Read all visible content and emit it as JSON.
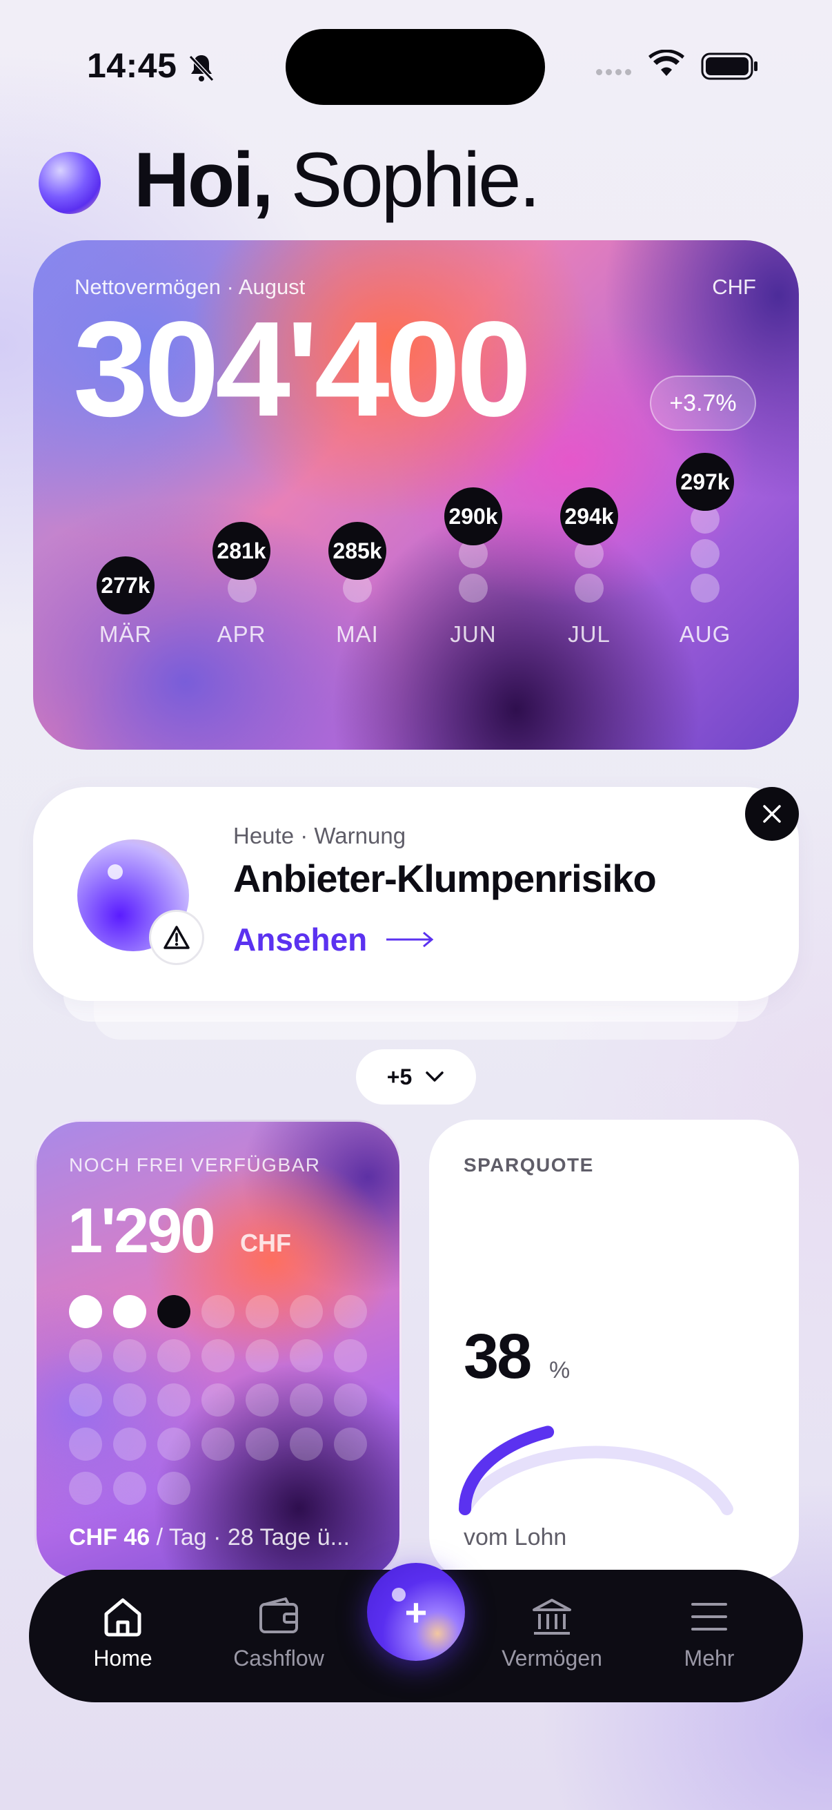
{
  "status_bar": {
    "time": "14:45",
    "icons": [
      "bell-slash-icon",
      "signal-icon",
      "wifi-icon",
      "battery-icon"
    ]
  },
  "greeting": {
    "hello": "Hoi,",
    "name": "Sophie."
  },
  "net_worth": {
    "label": "Nettovermögen · August",
    "currency": "CHF",
    "value": "304'400",
    "change": "+3.7%",
    "months": [
      {
        "label": "MÄR",
        "value": "277k"
      },
      {
        "label": "APR",
        "value": "281k"
      },
      {
        "label": "MAI",
        "value": "285k"
      },
      {
        "label": "JUN",
        "value": "290k"
      },
      {
        "label": "JUL",
        "value": "294k"
      },
      {
        "label": "AUG",
        "value": "297k"
      }
    ]
  },
  "alert": {
    "meta": "Heute · Warnung",
    "title": "Anbieter-Klumpenrisiko",
    "action": "Ansehen",
    "more_count": "+5"
  },
  "budget": {
    "label": "NOCH FREI VERFÜGBAR",
    "value": "1'290",
    "currency": "CHF",
    "days_elapsed": 2,
    "today_index": 3,
    "total_days": 31,
    "per_day": "CHF 46",
    "footer_rest": " / Tag · 28 Tage ü..."
  },
  "savings": {
    "label": "SPARQUOTE",
    "value": "38",
    "unit": "%",
    "subtitle": "vom Lohn",
    "rate": 0.38
  },
  "tabs": [
    {
      "label": "Home",
      "icon": "home-icon",
      "active": true
    },
    {
      "label": "Cashflow",
      "icon": "wallet-icon",
      "active": false
    },
    {
      "label": "Vermögen",
      "icon": "bank-icon",
      "active": false
    },
    {
      "label": "Mehr",
      "icon": "menu-icon",
      "active": false
    }
  ],
  "colors": {
    "accent": "#5b32f0",
    "dark": "#0b0a10"
  }
}
